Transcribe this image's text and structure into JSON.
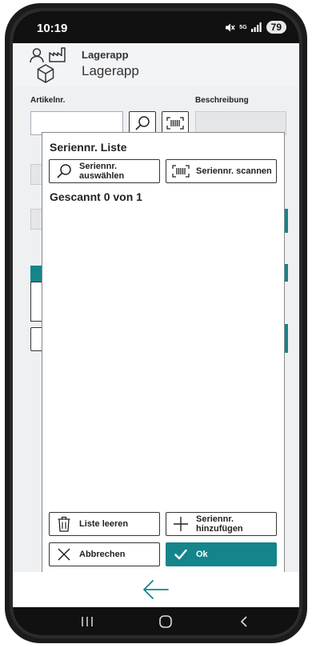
{
  "status": {
    "time": "10:19",
    "network": "5G",
    "battery": "79"
  },
  "app": {
    "title_small": "Lagerapp",
    "title_big": "Lagerapp"
  },
  "form": {
    "artikel_label": "Artikelnr.",
    "beschreibung_label": "Beschreibung"
  },
  "dialog": {
    "title": "Seriennr. Liste",
    "select_button": [
      "Seriennr.",
      "auswählen"
    ],
    "scan_button": "Seriennr. scannen",
    "scanned_text": "Gescannt 0 von 1",
    "clear_button": "Liste leeren",
    "add_button": [
      "Seriennr.",
      "hinzufügen"
    ],
    "cancel_button": "Abbrechen",
    "ok_button": "Ok"
  },
  "colors": {
    "accent": "#14858a",
    "header_bg": "#f3f4f6"
  },
  "icons": {
    "back": "arrow-left-icon",
    "search": "search-icon",
    "barcode": "barcode-icon",
    "trash": "trash-icon",
    "plus": "plus-icon",
    "close": "close-icon",
    "check": "check-icon"
  }
}
